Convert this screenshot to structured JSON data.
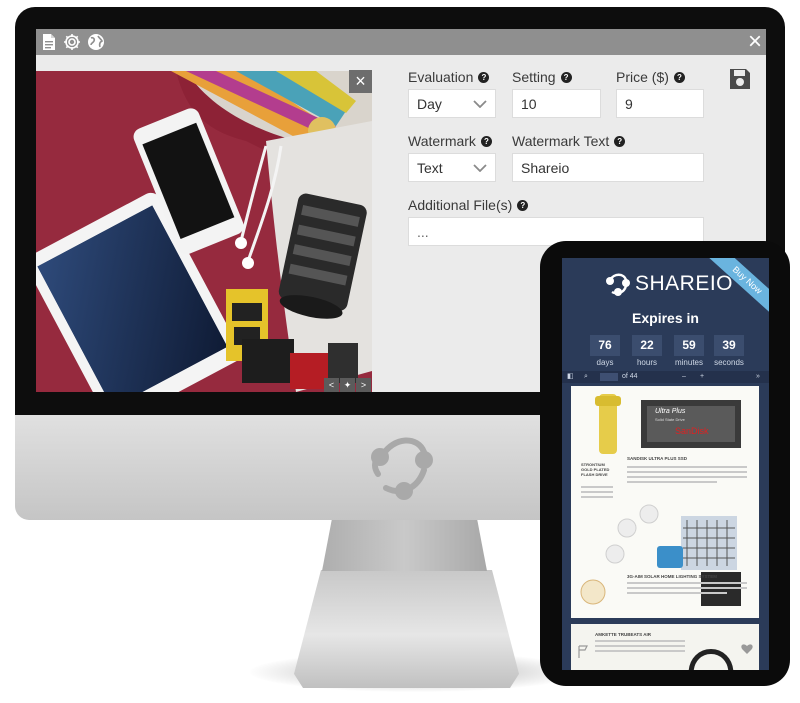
{
  "toolbar": {
    "icons": [
      "document-icon",
      "gear-icon",
      "globe-icon"
    ],
    "close_icon": "close-icon"
  },
  "preview": {
    "close_label": "×",
    "nav": [
      "<",
      "✦",
      ">"
    ]
  },
  "form": {
    "evaluation": {
      "label": "Evaluation",
      "value": "Day"
    },
    "setting": {
      "label": "Setting",
      "value": "10"
    },
    "price": {
      "label": "Price ($)",
      "value": "9"
    },
    "watermark": {
      "label": "Watermark",
      "value": "Text"
    },
    "watermark_text": {
      "label": "Watermark Text",
      "value": "Shareio"
    },
    "additional_files": {
      "label": "Additional File(s)",
      "value": "..."
    },
    "help_glyph": "?",
    "save_icon": "floppy-disk-icon"
  },
  "phone": {
    "ribbon": "Buy Now",
    "brand": "SHAREIO",
    "expires_label": "Expires in",
    "countdown": [
      {
        "value": "76",
        "unit": "days"
      },
      {
        "value": "22",
        "unit": "hours"
      },
      {
        "value": "59",
        "unit": "minutes"
      },
      {
        "value": "39",
        "unit": "seconds"
      }
    ],
    "pdf_toolbar": {
      "page_of": "of 44"
    },
    "products": {
      "ssd_name": "Ultra Plus",
      "ssd_sub": "Solid State Drive",
      "ssd_brand": "SanDisk",
      "ssd_title": "SANDISK ULTRA PLUS SSD",
      "flash_title": "STRONTIUM GOLD PLATED FLASH DRIVE",
      "solar_title": "3G-AIM SOLAR HOME LIGHTING SYSTEM",
      "next_title": "AMKETTE TRUBEATS AIR"
    }
  },
  "colors": {
    "topbar": "#8f8f8f",
    "screen_bg": "#ebebeb",
    "phone_bg": "#2b3b59",
    "ribbon": "#6ab4df"
  }
}
